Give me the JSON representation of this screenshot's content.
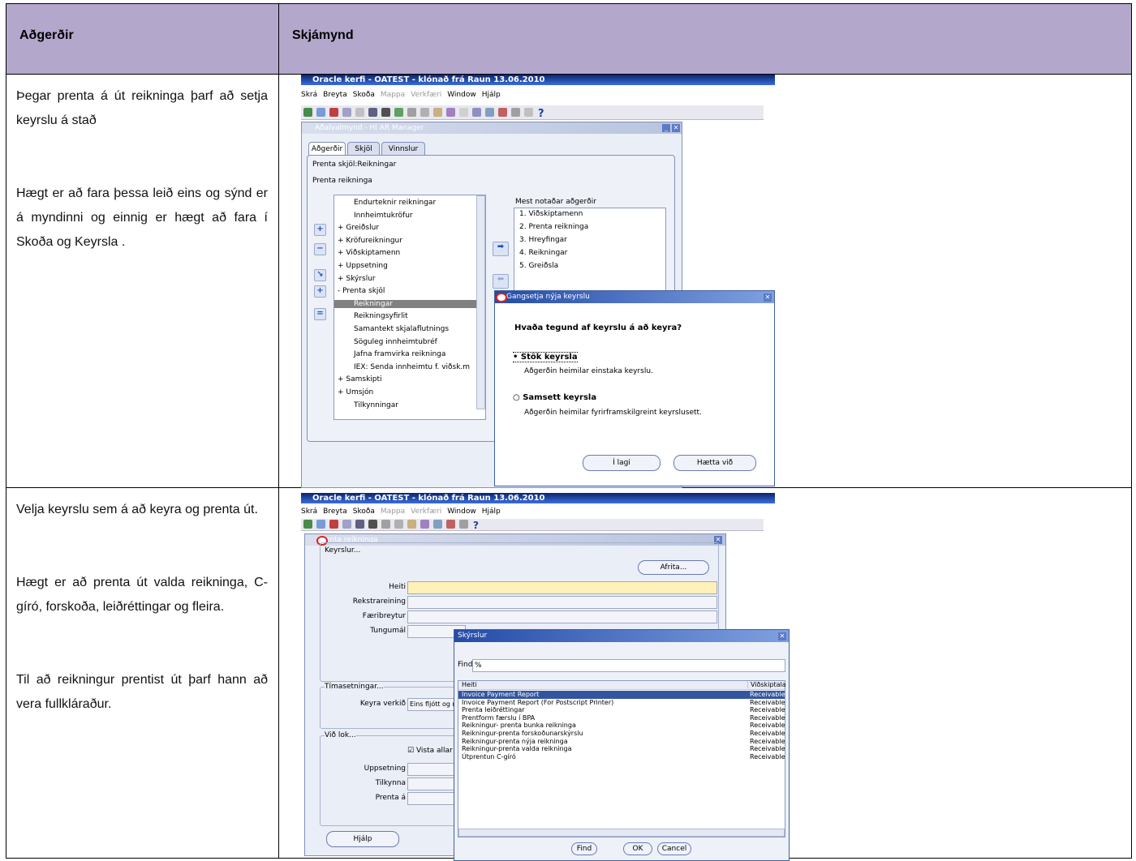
{
  "table": {
    "headers": [
      "Aðgerðir",
      "Skjámynd"
    ],
    "rows": [
      {
        "paragraphs": [
          "Þegar prenta á út reikninga þarf að setja keyrslu á stað",
          "Hægt er að fara þessa leið eins og sýnd er á myndinni og einnig er hægt að fara í Skoða og Keyrsla ."
        ]
      },
      {
        "paragraphs": [
          "Velja keyrslu sem á að keyra og prenta út.",
          "Hægt er að prenta út valda reikninga, C-gíró, forskoða, leiðréttingar og fleira.",
          "Til að reikningur prentist út þarf hann að vera fullkláraður."
        ]
      }
    ]
  },
  "shot1": {
    "app_title": "Oracle kerfi - OATEST - klónað frá Raun 13.06.2010",
    "menu": [
      "Skrá",
      "Breyta",
      "Skoða",
      "Mappa",
      "Verkfæri",
      "Window",
      "Hjálp"
    ],
    "window_title": "Aðalvalmynd - HI AR Manager",
    "tabs": [
      "Aðgerðir",
      "Skjöl",
      "Vinnslur"
    ],
    "path1": "Prenta skjöl:Reikningar",
    "path2": "Prenta reikninga",
    "tree": [
      "Endurteknir reikningar",
      "Innheimtukröfur",
      "+ Greiðslur",
      "+ Kröfureikningur",
      "+ Viðskiptamenn",
      "+ Uppsetning",
      "+ Skýrslur",
      "- Prenta skjöl",
      "Reikningar",
      "Reikningsyfirlit",
      "Samantekt skjalaflutnings",
      "Söguleg innheimtubréf",
      "Jafna framvirka reikninga",
      "IEX: Senda innheimtu f. viðsk.m",
      "+ Samskipti",
      "+ Umsjón",
      "Tilkynningar"
    ],
    "tree_selected": 8,
    "most_used_label": "Mest notaðar aðgerðir",
    "most_used": [
      "1. Viðskiptamenn",
      "2. Prenta reikninga",
      "3. Hreyfingar",
      "4. Reikningar",
      "5. Greiðsla"
    ],
    "dialog": {
      "title": "Gangsetja nýja keyrslu",
      "question": "Hvaða tegund af keyrslu á að keyra?",
      "opt1": "Stök keyrsla",
      "opt1_desc": "Aðgerðin heimilar einstaka keyrslu.",
      "opt2": "Samsett keyrsla",
      "opt2_desc": "Aðgerðin heimilar fyrirframskilgreint keyrslusett.",
      "ok": "Í lagi",
      "cancel": "Hætta við"
    }
  },
  "shot2": {
    "app_title": "Oracle kerfi - OATEST - klónað frá Raun 13.06.2010",
    "menu": [
      "Skrá",
      "Breyta",
      "Skoða",
      "Mappa",
      "Verkfæri",
      "Window",
      "Hjálp"
    ],
    "window_title": "Prenta reikninga",
    "group1": "Keyrslur...",
    "copy_btn": "Afrita...",
    "fields": [
      "Heiti",
      "Rekstrareining",
      "Færibreytur",
      "Tungumál"
    ],
    "group2": "Tímasetningar...",
    "run_label": "Keyra verkið",
    "run_value": "Eins fljótt og n",
    "group3": "Við lok...",
    "save_check": "Vista allar út",
    "fields2": [
      "Uppsetning",
      "Tilkynna",
      "Prenta á"
    ],
    "help_btn": "Hjálp",
    "lov": {
      "title": "Skýrslur",
      "find_label": "Find",
      "find_value": "%",
      "col1": "Heiti",
      "col2": "Viðskiptala",
      "rows": [
        [
          "Invoice Payment Report",
          "Receivable"
        ],
        [
          "Invoice Payment Report (For Postscript Printer)",
          "Receivable"
        ],
        [
          "Prenta leiðréttingar",
          "Receivable"
        ],
        [
          "Prentform færslu í BPA",
          "Receivable"
        ],
        [
          "Reikningur- prenta bunka reikninga",
          "Receivable"
        ],
        [
          "Reikningur-prenta forskoðunarskýrslu",
          "Receivable"
        ],
        [
          "Reikningur-prenta nýja reikninga",
          "Receivable"
        ],
        [
          "Reikningur-prenta valda reikninga",
          "Receivable"
        ],
        [
          "Útprentun C-gíró",
          "Receivable"
        ]
      ],
      "selected": 0,
      "btn_find": "Find",
      "btn_ok": "OK",
      "btn_cancel": "Cancel"
    }
  }
}
